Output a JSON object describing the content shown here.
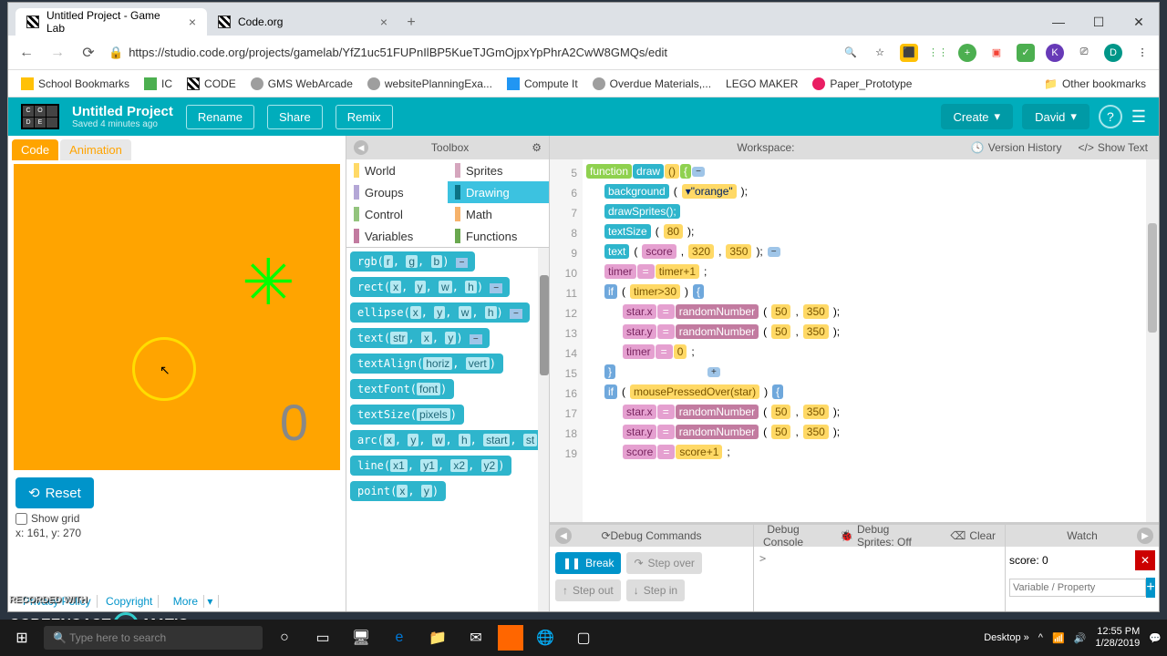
{
  "browser": {
    "tabs": [
      {
        "title": "Untitled Project - Game Lab"
      },
      {
        "title": "Code.org"
      }
    ],
    "url": "https://studio.code.org/projects/gamelab/YfZ1uc51FUPnIlBP5KueTJGmOjpxYpPhrA2CwW8GMQs/edit"
  },
  "bookmarks": {
    "items": [
      "School Bookmarks",
      "IC",
      "CODE",
      "GMS WebArcade",
      "websitePlanningExa...",
      "Compute It",
      "Overdue Materials,...",
      "LEGO MAKER",
      "Paper_Prototype"
    ],
    "other": "Other bookmarks"
  },
  "header": {
    "project_title": "Untitled Project",
    "saved": "Saved 4 minutes ago",
    "rename": "Rename",
    "share": "Share",
    "remix": "Remix",
    "create": "Create",
    "user": "David"
  },
  "leftPanel": {
    "codeTab": "Code",
    "animTab": "Animation",
    "score": "0",
    "reset": "Reset",
    "showGrid": "Show grid",
    "coords": "x: 161,  y: 270",
    "footer": [
      "Privacy Policy",
      "Copyright",
      "More"
    ]
  },
  "toolbox": {
    "title": "Toolbox",
    "cats": [
      {
        "name": "World",
        "color": "#ffd966"
      },
      {
        "name": "Sprites",
        "color": "#d5a6bd"
      },
      {
        "name": "Groups",
        "color": "#b4a7d6"
      },
      {
        "name": "Drawing",
        "color": "#3cc2e0"
      },
      {
        "name": "Control",
        "color": "#93c47d"
      },
      {
        "name": "Math",
        "color": "#f6b26b"
      },
      {
        "name": "Variables",
        "color": "#c27ba0"
      },
      {
        "name": "Functions",
        "color": "#6aa84f"
      }
    ],
    "blocks": [
      "rgb(r, g, b)",
      "rect(x, y, w, h)",
      "ellipse(x, y, w, h)",
      "text(str, x, y)",
      "textAlign(horiz, vert)",
      "textFont(font)",
      "textSize(pixels)",
      "arc(x, y, w, h, start, st",
      "line(x1, y1, x2, y2)",
      "point(x, y)"
    ]
  },
  "workspace": {
    "title": "Workspace:",
    "versionHistory": "Version History",
    "showText": "Show Text",
    "lines": {
      "5": {
        "n": "5"
      },
      "6": {
        "n": "6"
      },
      "7": {
        "n": "7"
      },
      "8": {
        "n": "8"
      },
      "9": {
        "n": "9"
      },
      "10": {
        "n": "10"
      },
      "11": {
        "n": "11"
      },
      "12": {
        "n": "12"
      },
      "13": {
        "n": "13"
      },
      "14": {
        "n": "14"
      },
      "15": {
        "n": "15"
      },
      "16": {
        "n": "16"
      },
      "17": {
        "n": "17"
      },
      "18": {
        "n": "18"
      },
      "19": {
        "n": "19"
      }
    },
    "code": {
      "function": "function",
      "draw": "draw",
      "empty": "()",
      "background": "background",
      "orange": "▾\"orange\"",
      "drawSprites": "drawSprites();",
      "textSize": "textSize",
      "ts_val": "80",
      "text": "text",
      "score": "score",
      "tx": "320",
      "ty": "350",
      "timer": "timer",
      "timer1": "timer+1",
      "if": "if",
      "cond1": "timer>30",
      "starx": "star.x",
      "stary": "star.y",
      "eq": "=",
      "randomNumber": "randomNumber",
      "r1": "50",
      "r2": "350",
      "zero": "0",
      "mousePressedOver": "mousePressedOver",
      "star": "star",
      "score1": "score+1"
    }
  },
  "debug": {
    "commands": "Debug Commands",
    "break": "Break",
    "stepOver": "Step over",
    "stepOut": "Step out",
    "stepIn": "Step in",
    "console": "Debug Console",
    "sprites": "Debug Sprites: Off",
    "clear": "Clear",
    "watch": "Watch",
    "watchVar": "score: 0",
    "watchPlaceholder": "Variable / Property"
  },
  "taskbar": {
    "search": "Type here to search",
    "desktop": "Desktop",
    "time": "12:55 PM",
    "date": "1/28/2019"
  },
  "watermark": {
    "rec": "RECORDED WITH",
    "brand1": "SCREENCAST",
    "brand2": "MATIC"
  }
}
